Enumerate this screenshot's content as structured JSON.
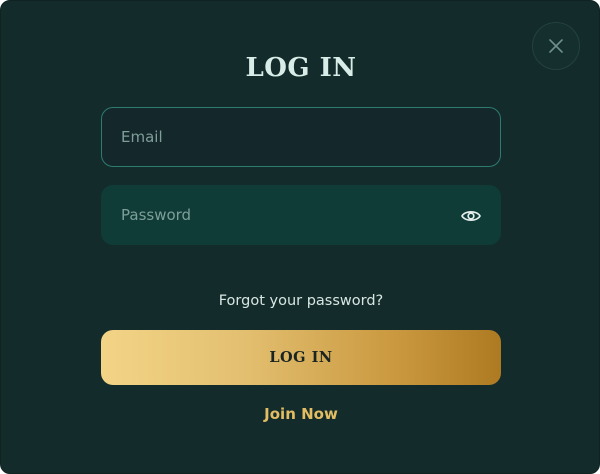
{
  "modal": {
    "title": "LOG IN",
    "close_icon": "close-icon"
  },
  "form": {
    "email": {
      "value": "",
      "placeholder": "Email"
    },
    "password": {
      "value": "",
      "placeholder": "Password",
      "toggle_icon": "eye-icon"
    },
    "forgot_label": "Forgot your password?",
    "submit_label": "LOG IN",
    "join_label": "Join Now"
  },
  "colors": {
    "background": "#132c2b",
    "email_border": "#2e7b70",
    "password_bg": "#0f3c37",
    "button_gradient_start": "#f3d486",
    "button_gradient_end": "#ad7a22",
    "link_gold": "#e3bd63"
  }
}
